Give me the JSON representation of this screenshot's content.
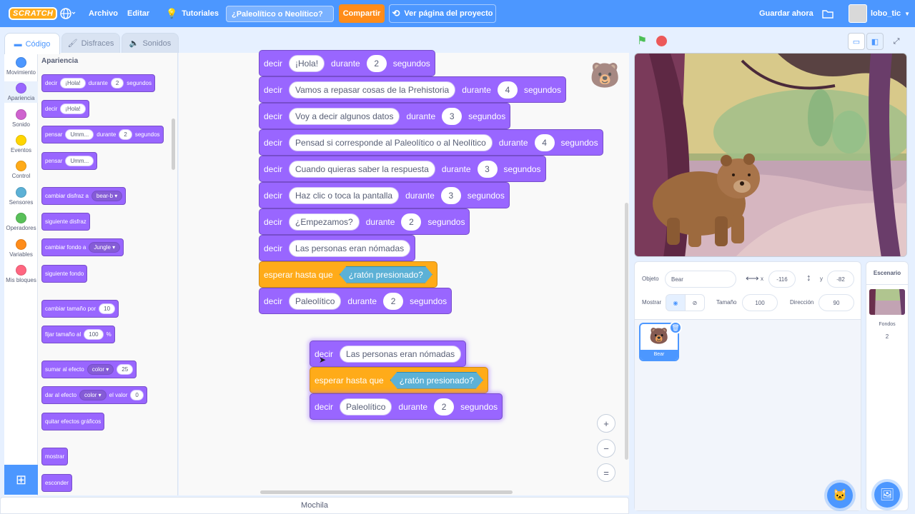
{
  "topbar": {
    "logo": "SCRATCH",
    "menu_file": "Archivo",
    "menu_edit": "Editar",
    "tutorials": "Tutoriales",
    "project_title": "¿Paleolítico o Neolítico?",
    "share": "Compartir",
    "see_project": "Ver página del proyecto",
    "save_now": "Guardar ahora",
    "username": "lobo_tic"
  },
  "tabs": {
    "code": "Código",
    "costumes": "Disfraces",
    "sounds": "Sonidos"
  },
  "categories": [
    {
      "label": "Movimiento",
      "color": "#4c97ff"
    },
    {
      "label": "Apariencia",
      "color": "#9966ff"
    },
    {
      "label": "Sonido",
      "color": "#cf63cf"
    },
    {
      "label": "Eventos",
      "color": "#ffd500"
    },
    {
      "label": "Control",
      "color": "#ffab19"
    },
    {
      "label": "Sensores",
      "color": "#5cb1d6"
    },
    {
      "label": "Operadores",
      "color": "#59c059"
    },
    {
      "label": "Variables",
      "color": "#ff8c1a"
    },
    {
      "label": "Mis bloques",
      "color": "#ff6680"
    }
  ],
  "palette": {
    "heading": "Apariencia",
    "b1": {
      "say": "decir",
      "text": "¡Hola!",
      "during": "durante",
      "secs": "2",
      "unit": "segundos"
    },
    "b2": {
      "say": "decir",
      "text": "¡Hola!"
    },
    "b3": {
      "think": "pensar",
      "text": "Umm...",
      "during": "durante",
      "secs": "2",
      "unit": "segundos"
    },
    "b4": {
      "think": "pensar",
      "text": "Umm..."
    },
    "b5": {
      "label": "cambiar disfraz a",
      "value": "bear-b"
    },
    "b6": {
      "label": "siguiente disfraz"
    },
    "b7": {
      "label": "cambiar fondo a",
      "value": "Jungle"
    },
    "b8": {
      "label": "siguiente fondo"
    },
    "b9": {
      "label": "cambiar tamaño por",
      "value": "10"
    },
    "b10": {
      "label": "fijar tamaño al",
      "value": "100",
      "unit": "%"
    },
    "b11": {
      "label": "sumar al efecto",
      "effect": "color",
      "value": "25"
    },
    "b12": {
      "label": "dar al efecto",
      "effect": "color",
      "mid": "el valor",
      "value": "0"
    },
    "b13": {
      "label": "quitar efectos gráficos"
    },
    "b14": {
      "label": "mostrar"
    },
    "b15": {
      "label": "esconder"
    }
  },
  "script_main": [
    {
      "text": "¡Hola!",
      "secs": "2"
    },
    {
      "text": "Vamos a repasar cosas de la Prehistoria",
      "secs": "4"
    },
    {
      "text": "Voy a decir algunos datos",
      "secs": "3"
    },
    {
      "text": "Pensad si corresponde al Paleolítico o al Neolítico",
      "secs": "4"
    },
    {
      "text": "Cuando quieras saber la respuesta",
      "secs": "3"
    },
    {
      "text": "Haz clic o toca la pantalla",
      "secs": "3"
    },
    {
      "text": "¿Empezamos?",
      "secs": "2"
    }
  ],
  "words": {
    "say": "decir",
    "during": "durante",
    "unit": "segundos",
    "wait_until": "esperar hasta que",
    "mouse_down": "¿ratón presionado?"
  },
  "script_main_tail": {
    "say_text": "Las personas eran nómadas",
    "final_text": "Paleolítico",
    "final_secs": "2"
  },
  "script_drag": {
    "say_text": "Las personas eran nómadas",
    "final_text": "Paleolítico",
    "final_secs": "2"
  },
  "zoom": {
    "in": "+",
    "out": "−",
    "reset": "="
  },
  "backpack": "Mochila",
  "sprite_info": {
    "object_label": "Objeto",
    "object_value": "Bear",
    "x_label": "x",
    "x_value": "-116",
    "y_label": "y",
    "y_value": "-82",
    "show_label": "Mostrar",
    "size_label": "Tamaño",
    "size_value": "100",
    "direction_label": "Dirección",
    "direction_value": "90",
    "sprite_name": "Bear"
  },
  "stage_panel": {
    "title": "Escenario",
    "backdrops_label": "Fondos",
    "backdrops_count": "2"
  }
}
